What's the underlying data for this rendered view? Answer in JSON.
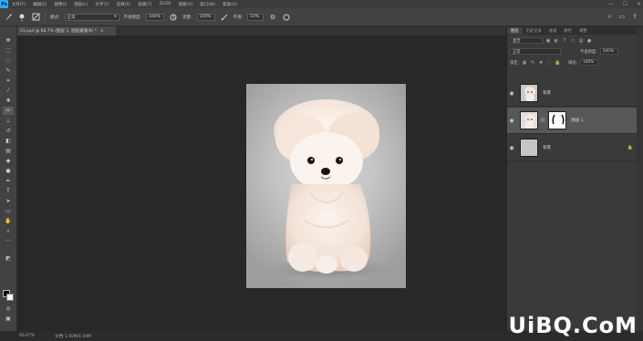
{
  "app": {
    "logo": "Ps"
  },
  "menu": [
    "文件(F)",
    "编辑(E)",
    "图像(I)",
    "图层(L)",
    "文字(Y)",
    "选择(S)",
    "滤镜(T)",
    "3D(D)",
    "视图(V)",
    "窗口(W)",
    "帮助(H)"
  ],
  "window_controls": [
    "—",
    "☐",
    "✕"
  ],
  "options_bar": {
    "brush_size": "·",
    "mode_label": "模式:",
    "mode_value": "正常",
    "opacity_label": "不透明度:",
    "opacity_value": "100%",
    "flow_label": "流量:",
    "flow_value": "100%",
    "smooth_label": "平滑:",
    "smooth_value": "10%"
  },
  "document_tab": {
    "title": "01.psd @ 66.7% (图层 1, 图层蒙版/8) *",
    "close": "×"
  },
  "layers_panel": {
    "tabs": [
      "图层",
      "历史记录",
      "通道",
      "路径",
      "调整"
    ],
    "kind_label": "类型",
    "blend_mode": "正常",
    "opacity_label": "不透明度:",
    "opacity_value": "100%",
    "lock_label": "锁定:",
    "fill_label": "填充:",
    "fill_value": "100%",
    "layers": [
      {
        "name": "背景",
        "visible": true,
        "selected": false,
        "locked": false
      },
      {
        "name": "图层 1",
        "visible": true,
        "selected": true,
        "locked": false
      },
      {
        "name": "背景",
        "visible": true,
        "selected": false,
        "locked": true
      }
    ]
  },
  "status_bar": {
    "zoom": "66.67%",
    "doc_size": "文档:1.50M/1.04M"
  },
  "watermark": {
    "text": "UiBQ.CoM"
  },
  "icons": {
    "eye": "👁",
    "lock": "🔒"
  },
  "colors": {
    "accent": "#31a8ff",
    "foreground": "#000000",
    "background": "#ffffff"
  }
}
